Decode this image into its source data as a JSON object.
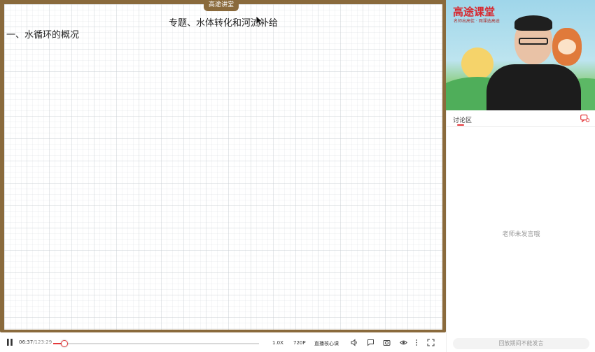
{
  "board": {
    "tab_label": "高途讲堂",
    "title": "专题、水体转化和河流补给",
    "section_heading": "一、水循环的概况"
  },
  "video": {
    "logo": "高途课堂",
    "logo_slogan": "名师出高徒 · 网课选高途"
  },
  "chat": {
    "title": "讨论区",
    "empty_message": "老师未发言哦",
    "input_placeholder": "回放期间不能发言"
  },
  "player": {
    "current_time": "06:37",
    "total_time": "/123:29",
    "progress": 0.053,
    "speed": "1.0X",
    "quality": "720P",
    "mode": "直播核心课"
  },
  "colors": {
    "accent": "#e4393c",
    "board_frame": "#8a6a3c",
    "logo": "#d7282f"
  }
}
